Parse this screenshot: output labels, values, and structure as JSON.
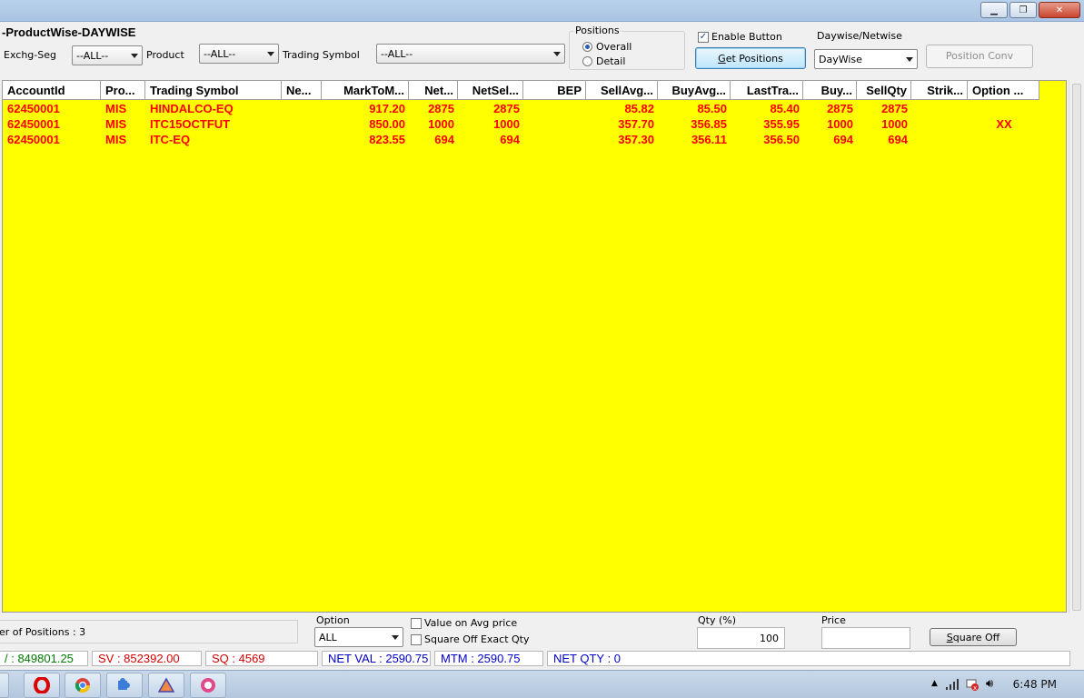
{
  "window": {
    "title": "-ProductWise-DAYWISE"
  },
  "filters": {
    "exchg_label": "Exchg-Seg",
    "exchg_value": "--ALL--",
    "product_label": "Product",
    "product_value": "--ALL--",
    "symbol_label": "Trading Symbol",
    "symbol_value": "--ALL--"
  },
  "positions_group": {
    "title": "Positions",
    "opt_overall": "Overall",
    "opt_detail": "Detail",
    "selected": "Overall"
  },
  "enable_button": {
    "label": "Enable Button",
    "checked": true
  },
  "get_positions": "Get Positions",
  "daywise": {
    "label": "Daywise/Netwise",
    "value": "DayWise"
  },
  "position_conv": "Position Conv",
  "grid": {
    "columns": [
      {
        "label": "AccountId",
        "align": "l"
      },
      {
        "label": "Pro...",
        "align": "l"
      },
      {
        "label": "Trading Symbol",
        "align": "l"
      },
      {
        "label": "Ne...",
        "align": "l"
      },
      {
        "label": "MarkToM...",
        "align": "r"
      },
      {
        "label": "Net...",
        "align": "r"
      },
      {
        "label": "NetSel...",
        "align": "r"
      },
      {
        "label": "BEP",
        "align": "r"
      },
      {
        "label": "SellAvg...",
        "align": "r"
      },
      {
        "label": "BuyAvg...",
        "align": "r"
      },
      {
        "label": "LastTra...",
        "align": "r"
      },
      {
        "label": "Buy...",
        "align": "r"
      },
      {
        "label": "SellQty",
        "align": "r"
      },
      {
        "label": "Strik...",
        "align": "r"
      },
      {
        "label": "Option ...",
        "align": "l"
      }
    ],
    "rows": [
      [
        "62450001",
        "MIS",
        "HINDALCO-EQ",
        "",
        "917.20",
        "2875",
        "2875",
        "",
        "85.82",
        "85.50",
        "85.40",
        "2875",
        "2875",
        "",
        ""
      ],
      [
        "62450001",
        "MIS",
        "ITC15OCTFUT",
        "",
        "850.00",
        "1000",
        "1000",
        "",
        "357.70",
        "356.85",
        "355.95",
        "1000",
        "1000",
        "",
        "XX"
      ],
      [
        "62450001",
        "MIS",
        "ITC-EQ",
        "",
        "823.55",
        "694",
        "694",
        "",
        "357.30",
        "356.11",
        "356.50",
        "694",
        "694",
        "",
        ""
      ]
    ]
  },
  "bottom": {
    "positions_count": "er of Positions : 3",
    "option_label": "Option",
    "option_value": "ALL",
    "value_on_avg": "Value on Avg  price",
    "square_off_exact": "Square Off Exact Qty",
    "qty_label": "Qty (%)",
    "qty_value": "100",
    "price_label": "Price",
    "price_value": "",
    "square_off_button": "Square Off"
  },
  "status": {
    "bv": "/ : 849801.25",
    "sv": "SV : 852392.00",
    "sq": "SQ : 4569",
    "net_val": "NET VAL : 2590.75",
    "mtm": "MTM : 2590.75",
    "net_qty": "NET QTY : 0",
    "green": "#007a00",
    "red": "#d40000",
    "blue": "#0000c8"
  },
  "taskbar": {
    "clock": "6:48 PM"
  }
}
